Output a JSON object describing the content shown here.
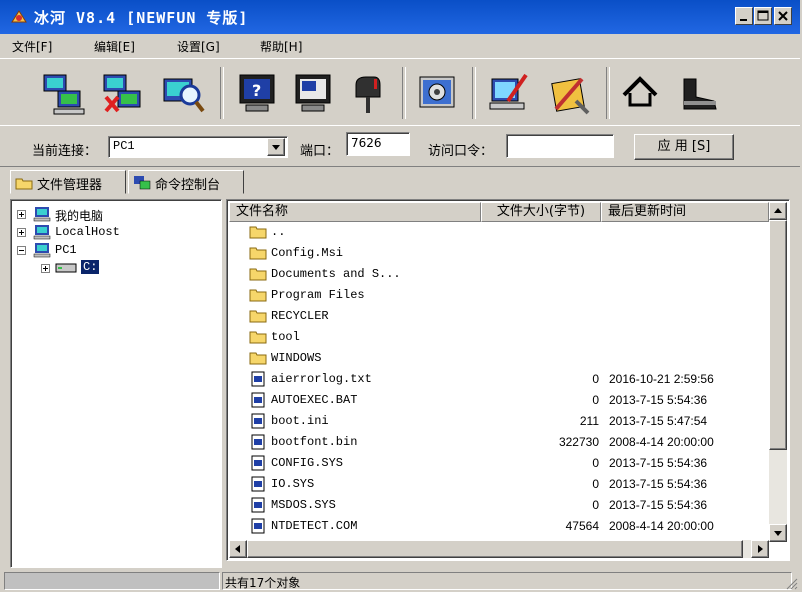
{
  "window": {
    "title": "冰河 V8.4 [NEWFUN 专版]"
  },
  "menu": [
    "文件[F]",
    "编辑[E]",
    "设置[G]",
    "帮助[H]"
  ],
  "toolbar": {
    "icons": [
      "connect-computer-icon",
      "disconnect-computer-icon",
      "search-computer-icon",
      "monitor-question-icon",
      "monitor-window-icon",
      "mailbox-icon",
      "screen-capture-icon",
      "edit-icon",
      "tools-icon",
      "house-icon",
      "boot-icon"
    ]
  },
  "conn": {
    "current_label": "当前连接：",
    "current_value": "PC1",
    "port_label": "端口：",
    "port_value": "7626",
    "password_label": "访问口令：",
    "password_value": "",
    "apply_label": "应 用 [S]"
  },
  "tabs": [
    "文件管理器",
    "命令控制台"
  ],
  "tree": [
    {
      "label": "我的电脑",
      "kind": "computer"
    },
    {
      "label": "LocalHost",
      "kind": "computer"
    },
    {
      "label": "PC1",
      "kind": "computer"
    },
    {
      "label": "C:",
      "kind": "drive"
    }
  ],
  "list": {
    "columns": [
      "文件名称",
      "文件大小(字节)",
      "最后更新时间"
    ],
    "rows": [
      {
        "name": "..",
        "size": "",
        "time": "",
        "type": "folder"
      },
      {
        "name": "Config.Msi",
        "size": "",
        "time": "",
        "type": "folder"
      },
      {
        "name": "Documents and S...",
        "size": "",
        "time": "",
        "type": "folder"
      },
      {
        "name": "Program Files",
        "size": "",
        "time": "",
        "type": "folder"
      },
      {
        "name": "RECYCLER",
        "size": "",
        "time": "",
        "type": "folder"
      },
      {
        "name": "tool",
        "size": "",
        "time": "",
        "type": "folder"
      },
      {
        "name": "WINDOWS",
        "size": "",
        "time": "",
        "type": "folder"
      },
      {
        "name": "aierrorlog.txt",
        "size": "0",
        "time": "2016-10-21 2:59:56",
        "type": "file"
      },
      {
        "name": "AUTOEXEC.BAT",
        "size": "0",
        "time": "2013-7-15 5:54:36",
        "type": "file"
      },
      {
        "name": "boot.ini",
        "size": "211",
        "time": "2013-7-15 5:47:54",
        "type": "file"
      },
      {
        "name": "bootfont.bin",
        "size": "322730",
        "time": "2008-4-14 20:00:00",
        "type": "file"
      },
      {
        "name": "CONFIG.SYS",
        "size": "0",
        "time": "2013-7-15 5:54:36",
        "type": "file"
      },
      {
        "name": "IO.SYS",
        "size": "0",
        "time": "2013-7-15 5:54:36",
        "type": "file"
      },
      {
        "name": "MSDOS.SYS",
        "size": "0",
        "time": "2013-7-15 5:54:36",
        "type": "file"
      },
      {
        "name": "NTDETECT.COM",
        "size": "47564",
        "time": "2008-4-14 20:00:00",
        "type": "file"
      }
    ]
  },
  "status": {
    "text": "共有17个对象"
  }
}
